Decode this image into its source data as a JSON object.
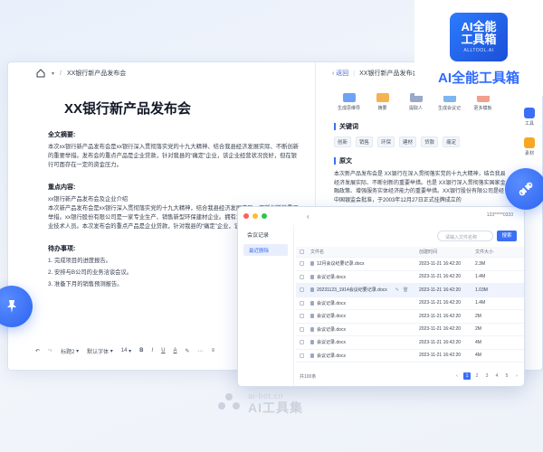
{
  "editor": {
    "tab_title": "XX银行新产品发布会",
    "doc_title": "XX银行新产品发布会",
    "summary_heading": "全文摘要:",
    "summary_text": "本次xx银行新产品发布会是xx银行深入贯彻落实党的十九大精神、结合我县经济发展实际、不断创新的重要举措。发布会的重点产品是企业贷款，针对我县的“痛定”企业，该企业经营状况良好，但在银行可面存在一定的资金压力。",
    "key_heading": "重点内容:",
    "key_text": "xx银行新产品发布会及企业介绍\n本次新产品发布会是xx银行深入贯彻落实党的十九大精神，结合我县经济发展实际，不断创新的重要举措。xx银行股份有限公司是一家专业生产、销售新型环保建材企业。拥有150余名下员工及多名专业技术人员。本次发布会的重点产品是企业贷款，针对我县的“痛定”企业，该企业经营状况良好，",
    "todo_heading": "待办事项:",
    "todo_items": [
      "1. 完成项目的进度报告。",
      "2. 安排与B公司的业务洽谈会议。",
      "3. 准备下月的销售预测报告。"
    ],
    "toolbar": {
      "heading": "标题2",
      "font": "默认字体",
      "size": "14"
    }
  },
  "assistant": {
    "back_label": "返回",
    "title": "XX银行新产品发布会",
    "actions": [
      {
        "label": "生成思维导",
        "color": "#6ea2f7"
      },
      {
        "label": "摘要",
        "color": "#f4b353"
      },
      {
        "label": "提取人",
        "color": "#9aa9c7"
      },
      {
        "label": "生成会议记",
        "color": "#7fb6f2"
      },
      {
        "label": "更多模板",
        "color": "#f2a08c"
      }
    ],
    "keywords_heading": "关键词",
    "keywords": [
      "创新",
      "销售",
      "环保",
      "建材",
      "贷款",
      "痛定"
    ],
    "original_heading": "原文",
    "original_text": "本次新产品发布会是 XX银行在深入贯彻落实党的十九大精神，结合我县经济发展实际、不断创新的重要举措。也是 XX银行深入贯彻落实国家金融政策、增强服务实体经济能力的重要举措。XX银行股份有限公司是经中国银监会批准，于2003年12月27日正式挂牌成立的"
  },
  "side_rail": {
    "items": [
      {
        "label": "工具",
        "color": "#3b6ff5"
      },
      {
        "label": "素材",
        "color": "#f6a723"
      }
    ]
  },
  "file_window": {
    "user_label": "123*****0333",
    "sidebar_title": "会议记录",
    "sidebar_item": "最近删除",
    "search_placeholder": "请输入文件名称",
    "search_button": "搜索",
    "columns": [
      "文件名",
      "创建时间",
      "文件大小"
    ],
    "rows": [
      {
        "name": "12月会议纪要记录.docx",
        "time": "2023-11-21 16:42:20",
        "size": "2.3M"
      },
      {
        "name": "会议记录.docx",
        "time": "2023-11-21 16:42:20",
        "size": "1.4M"
      },
      {
        "name": "20231123_1914会议纪要记录.docx",
        "time": "2023-11-21 16:42:20",
        "size": "1.03M"
      },
      {
        "name": "会议记录.docx",
        "time": "2023-11-21 16:42:20",
        "size": "1.4M"
      },
      {
        "name": "会议记录.docx",
        "time": "2023-11-21 16:42:20",
        "size": "2M"
      },
      {
        "name": "会议记录.docx",
        "time": "2023-11-21 16:42:20",
        "size": "2M"
      },
      {
        "name": "会议记录.docx",
        "time": "2023-11-21 16:42:20",
        "size": "4M"
      },
      {
        "name": "会议记录.docx",
        "time": "2023-11-21 16:42:20",
        "size": "4M"
      }
    ],
    "total": "共100条",
    "pages": [
      "1",
      "2",
      "3",
      "4",
      "5"
    ],
    "current_page": "1"
  },
  "brand": {
    "logo_text": "AI全能\n工具箱",
    "logo_sub": "ALLTOOL.AI",
    "name": "AI全能工具箱"
  },
  "watermark": {
    "url": "ai-bot.cn",
    "name": "AI工具集"
  }
}
